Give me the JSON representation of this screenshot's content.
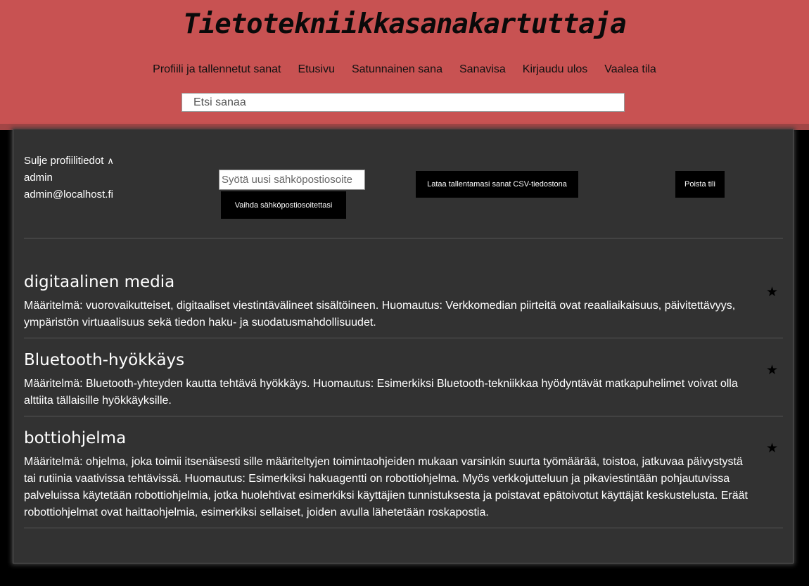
{
  "header": {
    "site_title": "Tietotekniikkasanakartuttaja",
    "nav": [
      {
        "label": "Profiili ja tallennetut sanat"
      },
      {
        "label": "Etusivu"
      },
      {
        "label": "Satunnainen sana"
      },
      {
        "label": "Sanavisa"
      },
      {
        "label": "Kirjaudu ulos"
      },
      {
        "label": "Vaalea tila"
      }
    ],
    "search_placeholder": "Etsi sanaa"
  },
  "profile": {
    "toggle_label": "Sulje profiilitiedot",
    "toggle_icon": "∧",
    "username": "admin",
    "email": "admin@localhost.fi",
    "email_input_placeholder": "Syötä uusi sähköpostiosoite",
    "change_email_button": "Vaihda sähköpostiosoitettasi",
    "download_csv_button": "Lataa tallentamasi sanat CSV-tiedostona",
    "delete_account_button": "Poista tili"
  },
  "saved_words": [
    {
      "term": "digitaalinen media",
      "definition": "Määritelmä: vuorovaikutteiset, digitaaliset viestintävälineet sisältöineen. Huomautus: Verkkomedian piirteitä ovat reaaliaikaisuus, päivitettävyys, ympäristön virtuaalisuus sekä tiedon haku- ja suodatusmahdollisuudet.",
      "star": "★"
    },
    {
      "term": "Bluetooth-hyökkäys",
      "definition": "Määritelmä: Bluetooth-yhteyden kautta tehtävä hyökkäys. Huomautus: Esimerkiksi Bluetooth-tekniikkaa hyödyntävät matkapuhelimet voivat olla alttiita tällaisille hyökkäyksille.",
      "star": "★"
    },
    {
      "term": "bottiohjelma",
      "definition": "Määritelmä: ohjelma, joka toimii itsenäisesti sille määriteltyjen toimintaohjeiden mukaan varsinkin suurta työmäärää, toistoa, jatkuvaa päivystystä tai rutiinia vaativissa tehtävissä. Huomautus: Esimerkiksi hakuagentti on robottiohjelma. Myös verkkojutteluun ja pikaviestintään pohjautuvissa palveluissa käytetään robottiohjelmia, jotka huolehtivat esimerkiksi käyttäjien tunnistuksesta ja poistavat epätoivotut käyttäjät keskustelusta. Eräät robottiohjelmat ovat haittaohjelmia, esimerkiksi sellaiset, joiden avulla lähetetään roskapostia.",
      "star": "★"
    }
  ],
  "colors": {
    "header_bg": "#c85252",
    "panel_bg": "#323232",
    "page_bg": "#000000",
    "button_bg": "#000000"
  }
}
